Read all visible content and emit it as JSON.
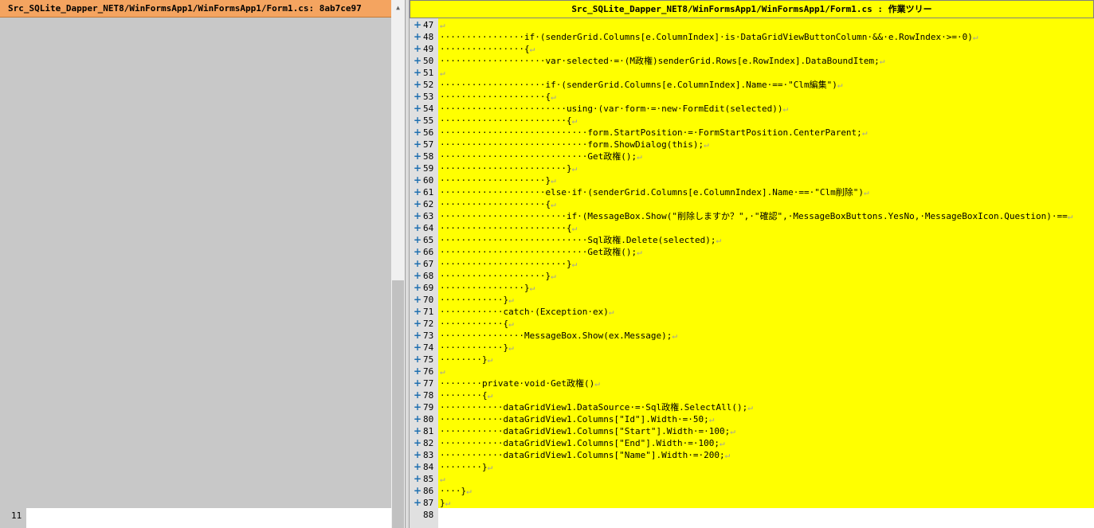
{
  "left": {
    "title": "Src_SQLite_Dapper_NET8/WinFormsApp1/WinFormsApp1/Form1.cs: 8ab7ce97",
    "line_number": "11"
  },
  "right": {
    "title": "Src_SQLite_Dapper_NET8/WinFormsApp1/WinFormsApp1/Form1.cs : 作業ツリー",
    "lines": [
      {
        "n": "47",
        "code": ""
      },
      {
        "n": "48",
        "code": "················if·(senderGrid.Columns[e.ColumnIndex]·is·DataGridViewButtonColumn·&&·e.RowIndex·>=·0)"
      },
      {
        "n": "49",
        "code": "················{"
      },
      {
        "n": "50",
        "code": "····················var·selected·=·(M政権)senderGrid.Rows[e.RowIndex].DataBoundItem;"
      },
      {
        "n": "51",
        "code": ""
      },
      {
        "n": "52",
        "code": "····················if·(senderGrid.Columns[e.ColumnIndex].Name·==·\"Clm編集\")"
      },
      {
        "n": "53",
        "code": "····················{"
      },
      {
        "n": "54",
        "code": "························using·(var·form·=·new·FormEdit(selected))"
      },
      {
        "n": "55",
        "code": "························{"
      },
      {
        "n": "56",
        "code": "····························form.StartPosition·=·FormStartPosition.CenterParent;"
      },
      {
        "n": "57",
        "code": "····························form.ShowDialog(this);"
      },
      {
        "n": "58",
        "code": "····························Get政権();"
      },
      {
        "n": "59",
        "code": "························}"
      },
      {
        "n": "60",
        "code": "····················}"
      },
      {
        "n": "61",
        "code": "····················else·if·(senderGrid.Columns[e.ColumnIndex].Name·==·\"Clm削除\")"
      },
      {
        "n": "62",
        "code": "····················{"
      },
      {
        "n": "63",
        "code": "························if·(MessageBox.Show(\"削除しますか？\",·\"確認\",·MessageBoxButtons.YesNo,·MessageBoxIcon.Question)·=="
      },
      {
        "n": "64",
        "code": "························{"
      },
      {
        "n": "65",
        "code": "····························Sql政権.Delete(selected);"
      },
      {
        "n": "66",
        "code": "····························Get政権();"
      },
      {
        "n": "67",
        "code": "························}"
      },
      {
        "n": "68",
        "code": "····················}"
      },
      {
        "n": "69",
        "code": "················}"
      },
      {
        "n": "70",
        "code": "············}"
      },
      {
        "n": "71",
        "code": "············catch·(Exception·ex)"
      },
      {
        "n": "72",
        "code": "············{"
      },
      {
        "n": "73",
        "code": "················MessageBox.Show(ex.Message);"
      },
      {
        "n": "74",
        "code": "············}"
      },
      {
        "n": "75",
        "code": "········}"
      },
      {
        "n": "76",
        "code": ""
      },
      {
        "n": "77",
        "code": "········private·void·Get政権()"
      },
      {
        "n": "78",
        "code": "········{"
      },
      {
        "n": "79",
        "code": "············dataGridView1.DataSource·=·Sql政権.SelectAll();"
      },
      {
        "n": "80",
        "code": "············dataGridView1.Columns[\"Id\"].Width·=·50;"
      },
      {
        "n": "81",
        "code": "············dataGridView1.Columns[\"Start\"].Width·=·100;"
      },
      {
        "n": "82",
        "code": "············dataGridView1.Columns[\"End\"].Width·=·100;"
      },
      {
        "n": "83",
        "code": "············dataGridView1.Columns[\"Name\"].Width·=·200;"
      },
      {
        "n": "84",
        "code": "········}"
      },
      {
        "n": "85",
        "code": ""
      },
      {
        "n": "86",
        "code": "····}"
      },
      {
        "n": "87",
        "code": "}"
      },
      {
        "n": "88",
        "code": ""
      }
    ],
    "eol_mark": "↵",
    "plus_glyph": "+",
    "colors": {
      "highlight": "#ffff00",
      "left_header": "#f4a460",
      "gutter": "#e0e0e0",
      "plus": "#1e6fb0"
    }
  },
  "icons": {
    "plus": "expand-plus-icon",
    "eol": "line-end-mark-icon"
  }
}
